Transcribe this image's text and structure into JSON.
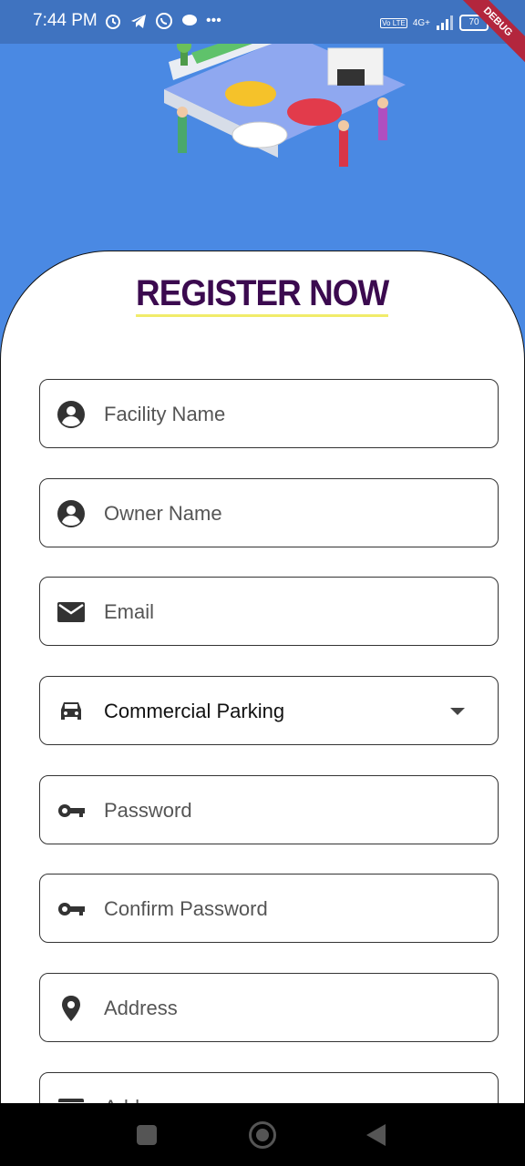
{
  "status_bar": {
    "time": "7:44 PM",
    "battery": "70",
    "network_label": "4G+",
    "volte_label": "Vo LTE"
  },
  "debug_banner": "DEBUG",
  "title": "REGISTER NOW",
  "form": {
    "facility_name": {
      "placeholder": "Facility Name",
      "icon": "account-circle-icon"
    },
    "owner_name": {
      "placeholder": "Owner Name",
      "icon": "account-circle-icon"
    },
    "email": {
      "placeholder": "Email",
      "icon": "mail-icon"
    },
    "facility_type": {
      "value": "Commercial Parking",
      "icon": "car-icon"
    },
    "password": {
      "placeholder": "Password",
      "icon": "key-icon"
    },
    "confirm_password": {
      "placeholder": "Confirm Password",
      "icon": "key-icon"
    },
    "address": {
      "placeholder": "Address",
      "icon": "location-pin-icon"
    },
    "next_field": {
      "placeholder": "Add",
      "icon": "card-icon"
    }
  },
  "colors": {
    "background": "#4a89e3",
    "title": "#3b0a4f",
    "title_underline": "#f1ec6a"
  }
}
